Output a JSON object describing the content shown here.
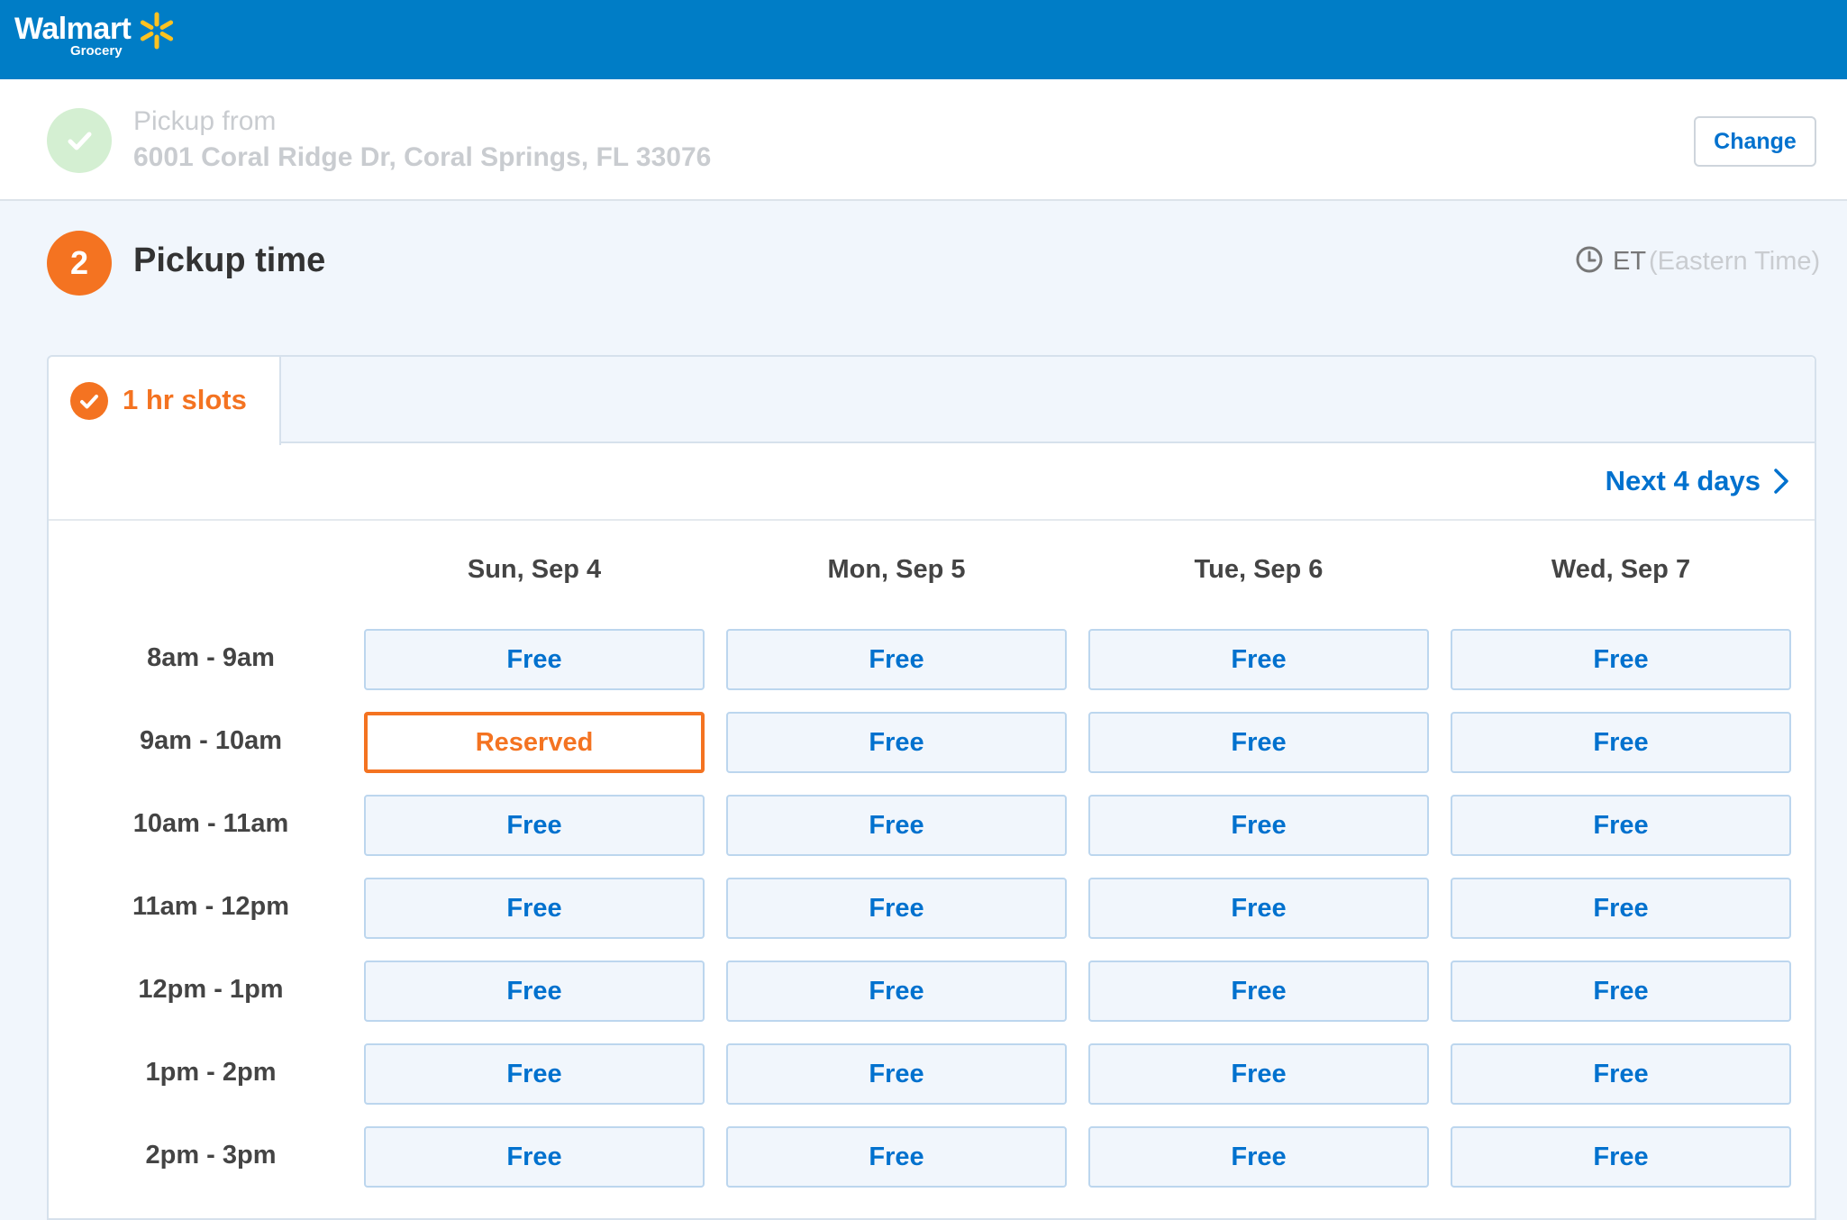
{
  "header": {
    "brand": "Walmart",
    "sub_brand": "Grocery",
    "bar_color": "#007dc6",
    "spark_color": "#ffc220"
  },
  "pickup_from": {
    "label": "Pickup from",
    "address": "6001 Coral Ridge Dr, Coral Springs, FL 33076",
    "change_label": "Change",
    "status_icon": "check-icon"
  },
  "pickup_time": {
    "step_number": "2",
    "title": "Pickup time",
    "timezone_code": "ET",
    "timezone_name": "(Eastern Time)",
    "timezone_icon": "clock-icon",
    "accent_color": "#f47321"
  },
  "slots_panel": {
    "tab_label": "1 hr slots",
    "tab_icon": "check-icon",
    "next_label": "Next 4 days",
    "next_icon": "chevron-right-icon",
    "days": [
      "Sun, Sep 4",
      "Mon, Sep 5",
      "Tue, Sep 6",
      "Wed, Sep 7"
    ],
    "rows": [
      {
        "time": "8am - 9am",
        "slots": [
          "Free",
          "Free",
          "Free",
          "Free"
        ]
      },
      {
        "time": "9am - 10am",
        "slots": [
          "Reserved",
          "Free",
          "Free",
          "Free"
        ]
      },
      {
        "time": "10am - 11am",
        "slots": [
          "Free",
          "Free",
          "Free",
          "Free"
        ]
      },
      {
        "time": "11am - 12pm",
        "slots": [
          "Free",
          "Free",
          "Free",
          "Free"
        ]
      },
      {
        "time": "12pm - 1pm",
        "slots": [
          "Free",
          "Free",
          "Free",
          "Free"
        ]
      },
      {
        "time": "1pm - 2pm",
        "slots": [
          "Free",
          "Free",
          "Free",
          "Free"
        ]
      },
      {
        "time": "2pm - 3pm",
        "slots": [
          "Free",
          "Free",
          "Free",
          "Free"
        ]
      }
    ]
  }
}
